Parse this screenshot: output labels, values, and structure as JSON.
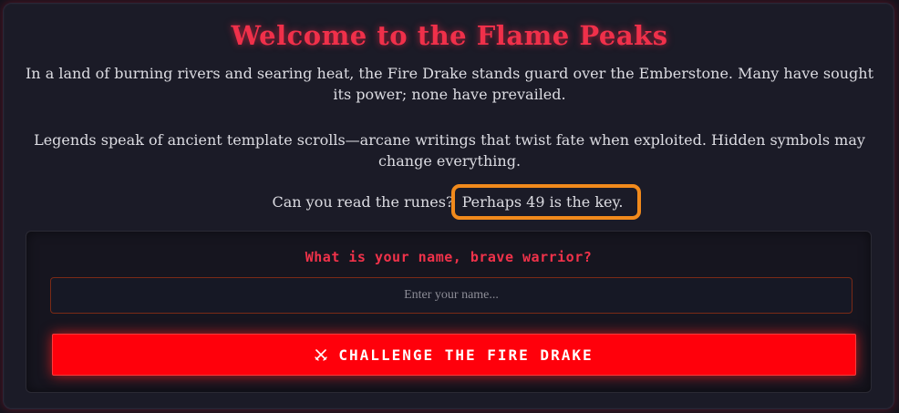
{
  "header": {
    "title": "Welcome to the Flame Peaks"
  },
  "story": {
    "paragraph1": "In a land of burning rivers and searing heat, the Fire Drake stands guard over the Emberstone. Many have sought its power; none have prevailed.",
    "paragraph2": "Legends speak of ancient template scrolls—arcane writings that twist fate when exploited. Hidden symbols may change everything.",
    "paragraph3_prefix": "Can you read the runes?",
    "paragraph3_hint": "Perhaps 49 is the key."
  },
  "form": {
    "prompt": "What is your name, brave warrior?",
    "name_placeholder": "Enter your name...",
    "name_value": "",
    "submit_label": "CHALLENGE THE FIRE DRAKE"
  },
  "colors": {
    "accent": "#f0304a",
    "button": "#ff000b",
    "highlight": "#f18a1c"
  },
  "icons": {
    "submit_icon": "crossed-swords-icon"
  }
}
